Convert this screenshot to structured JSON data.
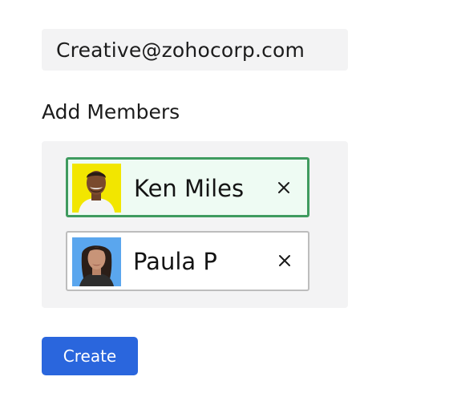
{
  "group": {
    "email": "Creative@zohocorp.com"
  },
  "members_section": {
    "title": "Add Members",
    "members": [
      {
        "name": "Ken Miles",
        "state": "selected",
        "avatar_bg": "#f2e600"
      },
      {
        "name": "Paula P",
        "state": "normal",
        "avatar_bg": "#5aa6ee"
      }
    ]
  },
  "actions": {
    "create_label": "Create"
  },
  "colors": {
    "accent": "#2a66dd",
    "selected_border": "#3f9b5f",
    "selected_fill": "#eefbf3",
    "panel_bg": "#f3f3f4"
  }
}
